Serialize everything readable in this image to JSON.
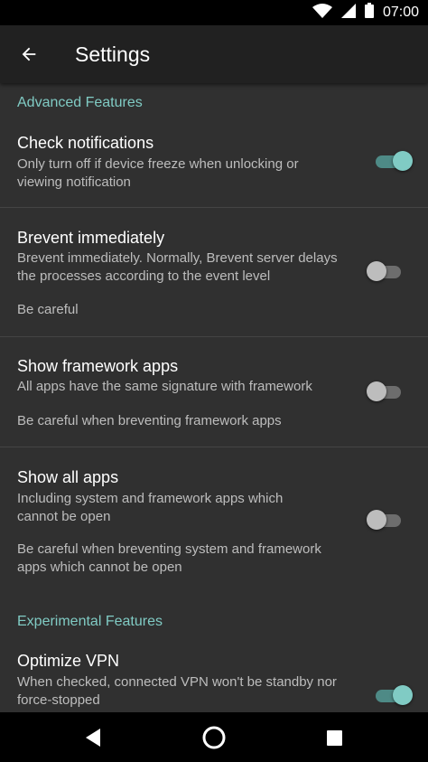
{
  "status_bar": {
    "time": "07:00",
    "icons": [
      "wifi-icon",
      "signal-icon",
      "battery-icon"
    ]
  },
  "app_bar": {
    "title": "Settings",
    "back_icon": "arrow-back-icon"
  },
  "categories": {
    "advanced": "Advanced Features",
    "experimental": "Experimental Features"
  },
  "preferences": [
    {
      "title": "Check notifications",
      "summary": "Only turn off if device freeze when unlocking or viewing notification",
      "note": "",
      "checked": true
    },
    {
      "title": "Brevent immediately",
      "summary": "Brevent immediately. Normally, Brevent server delays the processes according to the event level",
      "note": "Be careful",
      "checked": false
    },
    {
      "title": "Show framework apps",
      "summary": "All apps have the same signature with framework",
      "note": "Be careful when breventing framework apps",
      "checked": false
    },
    {
      "title": "Show all apps",
      "summary": "Including system and framework apps which cannot be open",
      "note": "Be careful when breventing system and framework apps which cannot be open",
      "checked": false
    },
    {
      "title": "Optimize VPN",
      "summary": "When checked, connected VPN won't be standby nor force-stopped",
      "note": "",
      "checked": true
    }
  ],
  "colors": {
    "accent": "#80cbc4",
    "background": "#303030",
    "app_bar": "#212121"
  },
  "nav_bar": {
    "icons": [
      "back-triangle-icon",
      "home-circle-icon",
      "recents-square-icon"
    ]
  }
}
